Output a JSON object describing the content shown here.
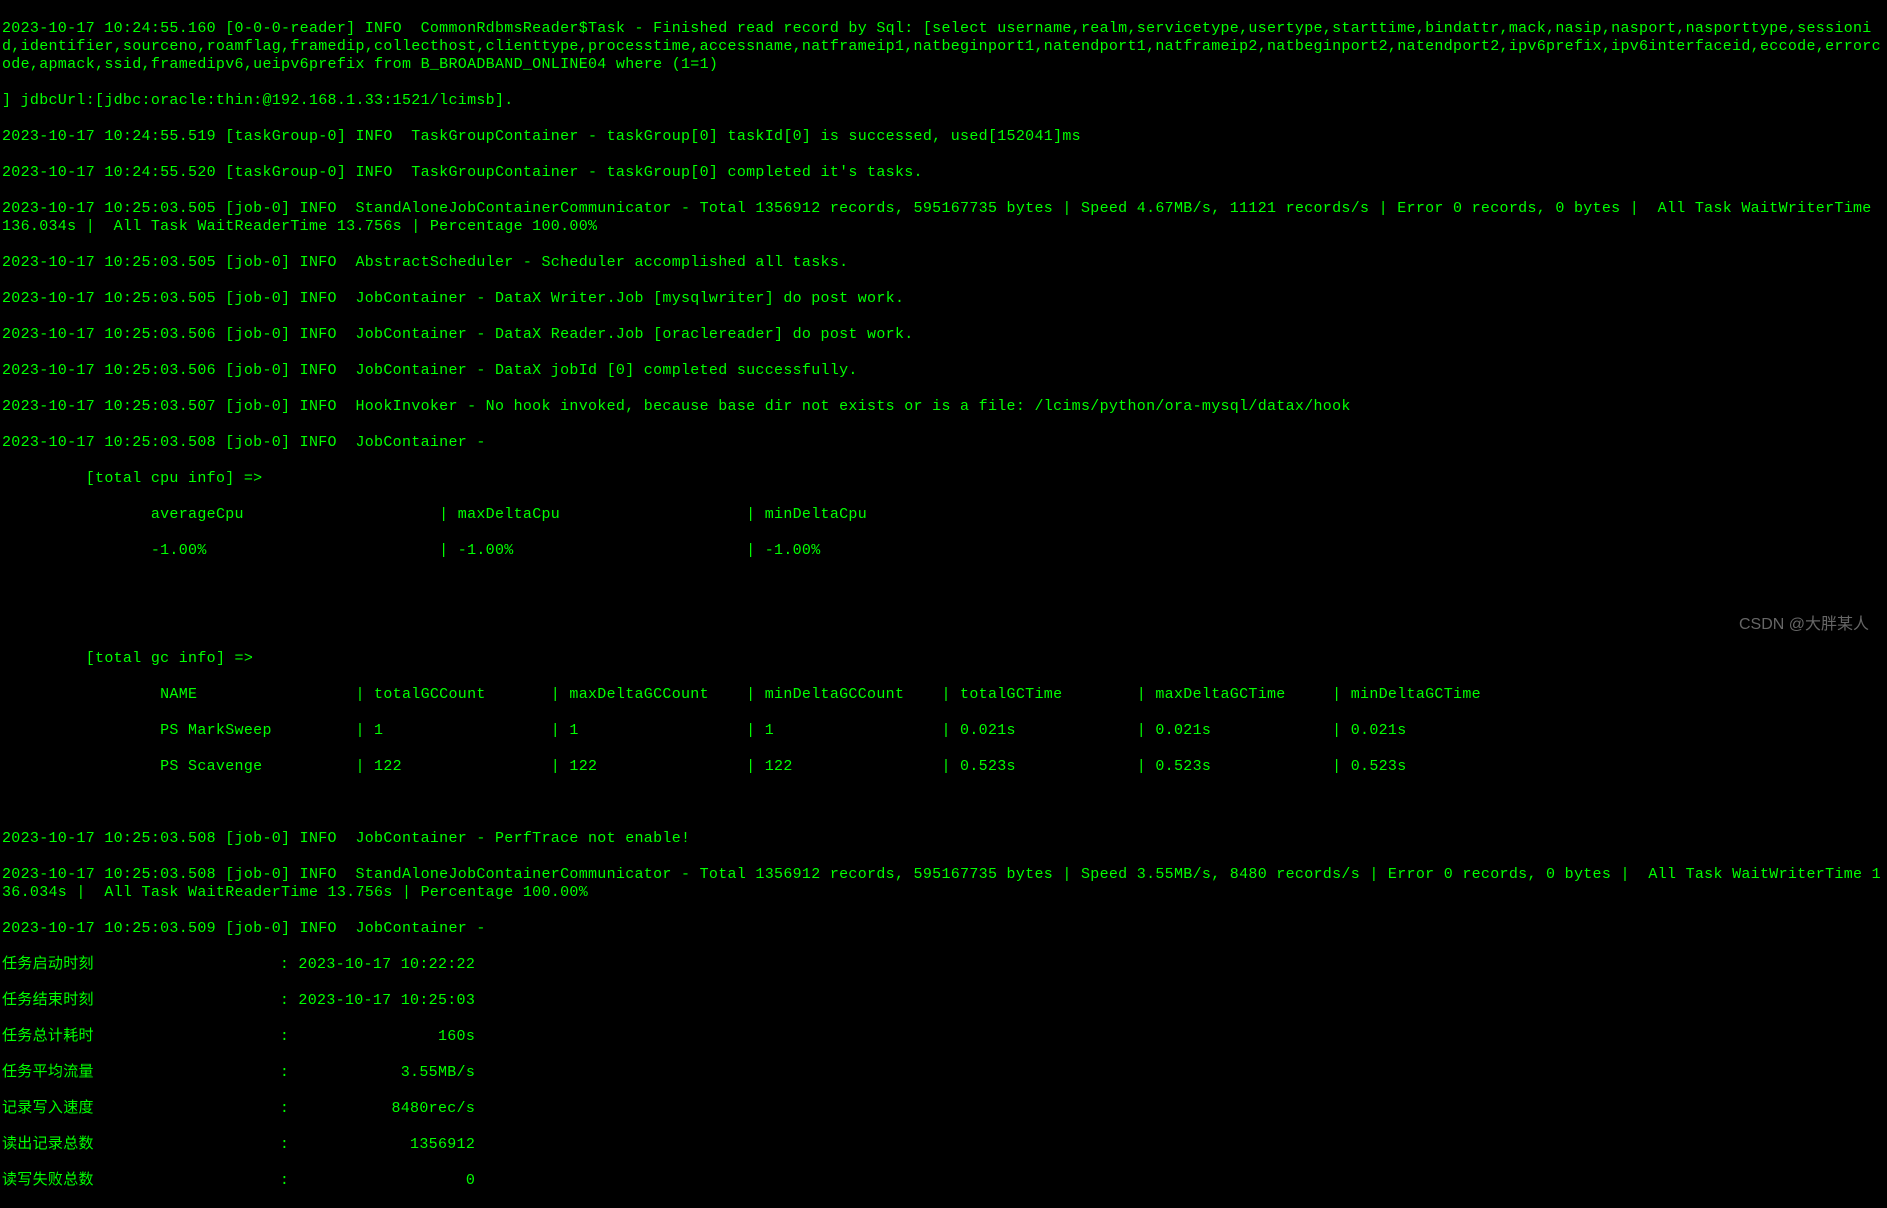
{
  "lines": {
    "l0": "2023-10-17 10:24:55.160 [0-0-0-reader] INFO  CommonRdbmsReader$Task - Finished read record by Sql: [select username,realm,servicetype,usertype,starttime,bindattr,mack,nasip,nasport,nasporttype,sessionid,identifier,sourceno,roamflag,framedip,collecthost,clienttype,processtime,accessname,natframeip1,natbeginport1,natendport1,natframeip2,natbeginport2,natendport2,ipv6prefix,ipv6interfaceid,eccode,errorcode,apmack,ssid,framedipv6,ueipv6prefix from B_BROADBAND_ONLINE04 where (1=1)",
    "l1": "] jdbcUrl:[jdbc:oracle:thin:@192.168.1.33:1521/lcimsb].",
    "l2": "2023-10-17 10:24:55.519 [taskGroup-0] INFO  TaskGroupContainer - taskGroup[0] taskId[0] is successed, used[152041]ms",
    "l3": "2023-10-17 10:24:55.520 [taskGroup-0] INFO  TaskGroupContainer - taskGroup[0] completed it's tasks.",
    "l4": "2023-10-17 10:25:03.505 [job-0] INFO  StandAloneJobContainerCommunicator - Total 1356912 records, 595167735 bytes | Speed 4.67MB/s, 11121 records/s | Error 0 records, 0 bytes |  All Task WaitWriterTime 136.034s |  All Task WaitReaderTime 13.756s | Percentage 100.00%",
    "l5": "2023-10-17 10:25:03.505 [job-0] INFO  AbstractScheduler - Scheduler accomplished all tasks.",
    "l6": "2023-10-17 10:25:03.505 [job-0] INFO  JobContainer - DataX Writer.Job [mysqlwriter] do post work.",
    "l7": "2023-10-17 10:25:03.506 [job-0] INFO  JobContainer - DataX Reader.Job [oraclereader] do post work.",
    "l8": "2023-10-17 10:25:03.506 [job-0] INFO  JobContainer - DataX jobId [0] completed successfully.",
    "l9": "2023-10-17 10:25:03.507 [job-0] INFO  HookInvoker - No hook invoked, because base dir not exists or is a file: /lcims/python/ora-mysql/datax/hook",
    "l10": "2023-10-17 10:25:03.508 [job-0] INFO  JobContainer - ",
    "l11": "         [total cpu info] => ",
    "l12": "                averageCpu                     | maxDeltaCpu                    | minDeltaCpu                    ",
    "l13": "                -1.00%                         | -1.00%                         | -1.00%",
    "blank": "                        ",
    "l14": "         [total gc info] => ",
    "l15": "                 NAME                 | totalGCCount       | maxDeltaGCCount    | minDeltaGCCount    | totalGCTime        | maxDeltaGCTime     | minDeltaGCTime     ",
    "l16": "                 PS MarkSweep         | 1                  | 1                  | 1                  | 0.021s             | 0.021s             | 0.021s             ",
    "l17": "                 PS Scavenge          | 122                | 122                | 122                | 0.523s             | 0.523s             | 0.523s             ",
    "l18": "2023-10-17 10:25:03.508 [job-0] INFO  JobContainer - PerfTrace not enable!",
    "l19": "2023-10-17 10:25:03.508 [job-0] INFO  StandAloneJobContainerCommunicator - Total 1356912 records, 595167735 bytes | Speed 3.55MB/s, 8480 records/s | Error 0 records, 0 bytes |  All Task WaitWriterTime 136.034s |  All Task WaitReaderTime 13.756s | Percentage 100.00%",
    "l20": "2023-10-17 10:25:03.509 [job-0] INFO  JobContainer - ",
    "s1": "任务启动时刻                    : 2023-10-17 10:22:22",
    "s2": "任务结束时刻                    : 2023-10-17 10:25:03",
    "s3": "任务总计耗时                    :                160s",
    "s4": "任务平均流量                    :            3.55MB/s",
    "s5": "记录写入速度                    :           8480rec/s",
    "s6": "读出记录总数                    :             1356912",
    "s7": "读写失败总数                    :                   0"
  },
  "watermark": "CSDN @大胖某人"
}
